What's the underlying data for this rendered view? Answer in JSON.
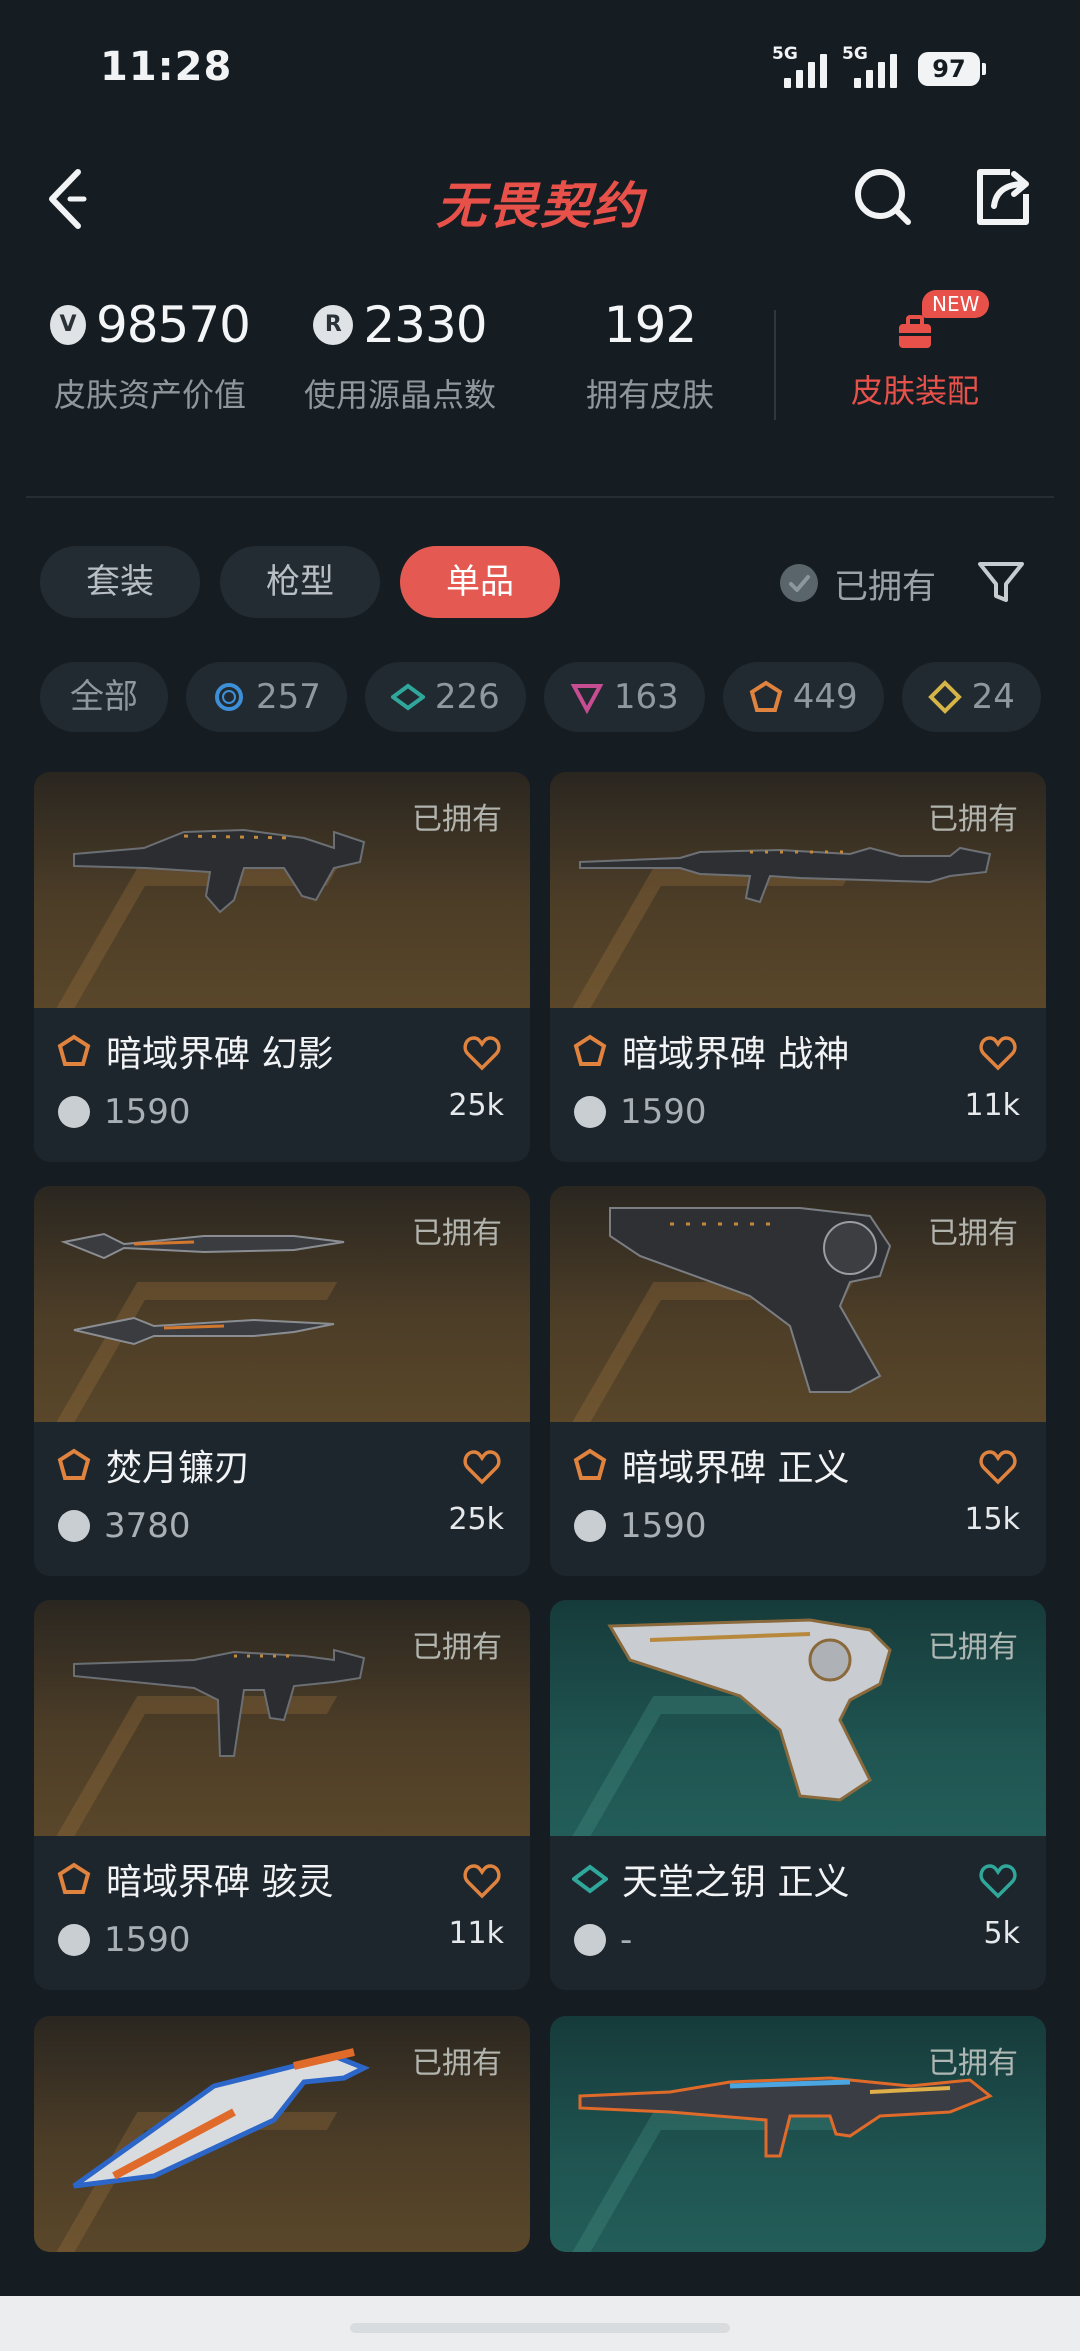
{
  "status_bar": {
    "time": "11:28",
    "signal1": "5G",
    "signal2": "5G",
    "battery": "97"
  },
  "header": {
    "title": "无畏契约"
  },
  "stats": {
    "asset_value": "98570",
    "asset_value_label": "皮肤资产价值",
    "points_used": "2330",
    "points_used_label": "使用源晶点数",
    "skins_owned": "192",
    "skins_owned_label": "拥有皮肤",
    "equip_label": "皮肤装配",
    "new_badge": "NEW"
  },
  "tabs": [
    {
      "label": "套装",
      "active": false
    },
    {
      "label": "枪型",
      "active": false
    },
    {
      "label": "单品",
      "active": true
    }
  ],
  "owned_filter_label": "已拥有",
  "chips": [
    {
      "label": "全部",
      "icon": "none"
    },
    {
      "label": "257",
      "icon": "select-tier-icon",
      "color": "#3d8fd8"
    },
    {
      "label": "226",
      "icon": "deluxe-tier-icon",
      "color": "#2fa79a"
    },
    {
      "label": "163",
      "icon": "premium-tier-icon",
      "color": "#c74d93"
    },
    {
      "label": "449",
      "icon": "ultra-tier-icon",
      "color": "#e0833e"
    },
    {
      "label": "24",
      "icon": "exclusive-tier-icon",
      "color": "#d5b548"
    }
  ],
  "cards": [
    {
      "name": "暗域界碑 幻影",
      "price": "1590",
      "likes": "25k",
      "owned": "已拥有",
      "tier_color": "#e0833e",
      "bg": "gold",
      "weapon": "rifle"
    },
    {
      "name": "暗域界碑 战神",
      "price": "1590",
      "likes": "11k",
      "owned": "已拥有",
      "tier_color": "#e0833e",
      "bg": "gold",
      "weapon": "sniper"
    },
    {
      "name": "焚月镰刃",
      "price": "3780",
      "likes": "25k",
      "owned": "已拥有",
      "tier_color": "#e0833e",
      "bg": "gold",
      "weapon": "knives"
    },
    {
      "name": "暗域界碑 正义",
      "price": "1590",
      "likes": "15k",
      "owned": "已拥有",
      "tier_color": "#e0833e",
      "bg": "gold",
      "weapon": "revolver"
    },
    {
      "name": "暗域界碑 骇灵",
      "price": "1590",
      "likes": "11k",
      "owned": "已拥有",
      "tier_color": "#e0833e",
      "bg": "gold",
      "weapon": "smg"
    },
    {
      "name": "天堂之钥 正义",
      "price": "-",
      "likes": "5k",
      "owned": "已拥有",
      "tier_color": "#2fa79a",
      "bg": "teal",
      "weapon": "revolver-silver"
    },
    {
      "name": "",
      "price": "",
      "likes": "",
      "owned": "已拥有",
      "tier_color": "#e0833e",
      "bg": "gold",
      "weapon": "blade"
    },
    {
      "name": "",
      "price": "",
      "likes": "",
      "owned": "已拥有",
      "tier_color": "#2fa79a",
      "bg": "teal",
      "weapon": "rifle-color"
    }
  ]
}
